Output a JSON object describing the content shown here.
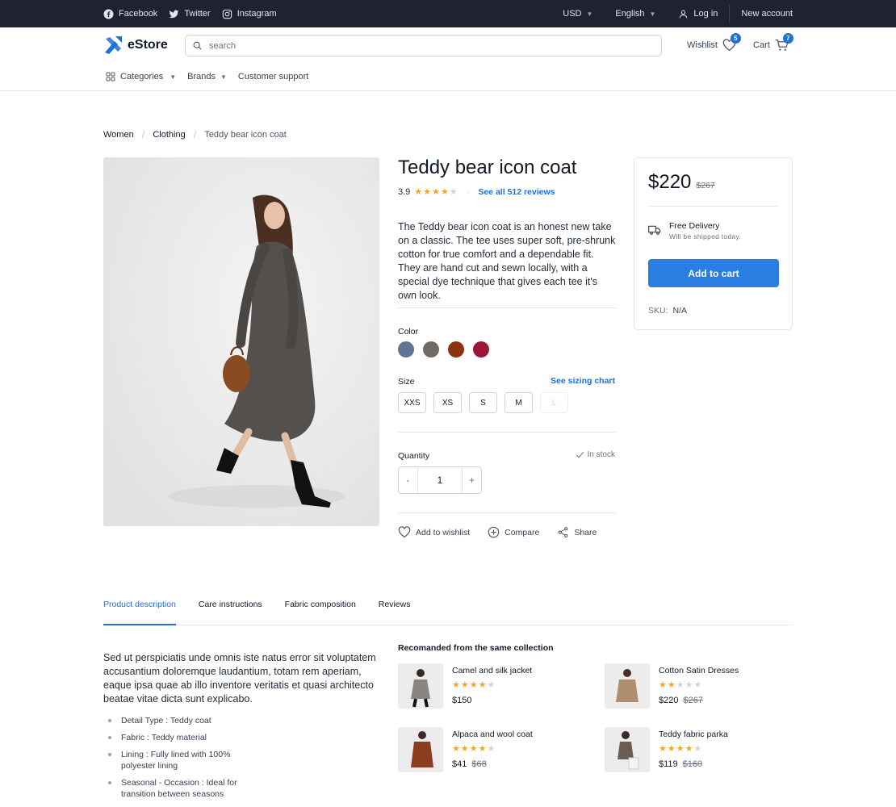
{
  "topbar": {
    "social": [
      {
        "label": "Facebook",
        "icon": "facebook-icon"
      },
      {
        "label": "Twitter",
        "icon": "twitter-icon"
      },
      {
        "label": "Instagram",
        "icon": "instagram-icon"
      }
    ],
    "currency": "USD",
    "language": "English",
    "login": "Log in",
    "new_account": "New account"
  },
  "header": {
    "brand": "eStore",
    "search_placeholder": "search",
    "wishlist_label": "Wishlist",
    "wishlist_count": "5",
    "cart_label": "Cart",
    "cart_count": "7"
  },
  "nav": {
    "categories": "Categories",
    "brands": "Brands",
    "support": "Customer support"
  },
  "breadcrumb": [
    "Women",
    "Clothing",
    "Teddy bear icon coat"
  ],
  "product": {
    "title": "Teddy bear icon coat",
    "rating": "3.9",
    "rating_stars": 4,
    "reviews_link": "See all 512 reviews",
    "description": "The Teddy bear icon coat is an honest new take on a classic. The tee uses super soft, pre-shrunk cotton for true comfort and a dependable fit. They are hand cut and sewn locally, with a special dye technique that gives each tee it's own look.",
    "color_label": "Color",
    "colors": [
      "#5f7593",
      "#6f6a66",
      "#8a3411",
      "#9c1735"
    ],
    "size_label": "Size",
    "sizing_chart": "See sizing chart",
    "sizes": [
      {
        "label": "XXS",
        "available": true
      },
      {
        "label": "XS",
        "available": true
      },
      {
        "label": "S",
        "available": true
      },
      {
        "label": "M",
        "available": true
      },
      {
        "label": "L",
        "available": false
      }
    ],
    "quantity_label": "Quantity",
    "stock": "In stock",
    "quantity": "1",
    "minus": "-",
    "plus": "+",
    "add_wishlist": "Add to wishlist",
    "compare": "Compare",
    "share": "Share"
  },
  "card": {
    "price": "$220",
    "old_price": "$267",
    "delivery_title": "Free Delivery",
    "delivery_sub": "Will be shipped today.",
    "add_to_cart": "Add to cart",
    "sku_label": "SKU:",
    "sku_value": "N/A"
  },
  "tabs": [
    "Product description",
    "Care instructions",
    "Fabric composition",
    "Reviews"
  ],
  "details": {
    "text": "Sed ut perspiciatis unde omnis iste natus error sit voluptatem accusantium doloremque laudantium, totam rem aperiam, eaque ipsa quae ab illo inventore veritatis et quasi architecto beatae vitae dicta sunt explicabo.",
    "features": [
      "Detail Type : Teddy coat",
      "Fabric : Teddy material",
      "Lining : Fully lined with 100% polyester lining",
      "Seasonal - Occasion : Ideal for transition between seasons"
    ]
  },
  "recommended": {
    "title": "Recomanded from the same collection",
    "items": [
      {
        "name": "Camel and silk jacket",
        "stars": 4,
        "price": "$150",
        "old_price": ""
      },
      {
        "name": "Cotton Satin Dresses",
        "stars": 2,
        "price": "$220",
        "old_price": "$267"
      },
      {
        "name": "Alpaca and wool coat",
        "stars": 4,
        "price": "$41",
        "old_price": "$68"
      },
      {
        "name": "Teddy fabric parka",
        "stars": 4,
        "price": "$119",
        "old_price": "$160"
      }
    ]
  }
}
